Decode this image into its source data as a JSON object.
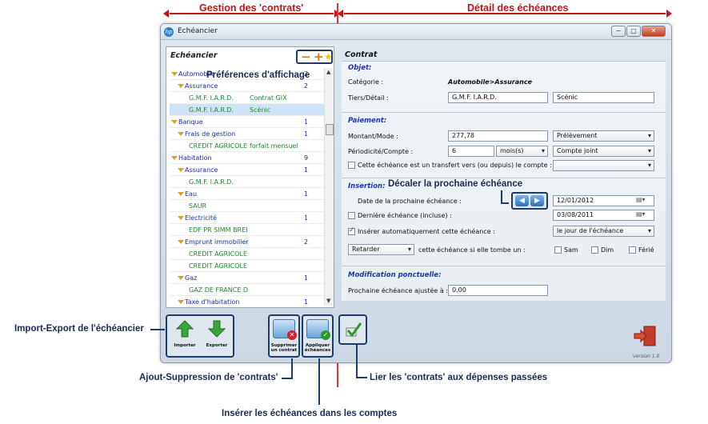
{
  "headers": {
    "left": "Gestion des 'contrats'",
    "right": "Détail des échéances"
  },
  "window": {
    "title": "Echéancier",
    "app_icon": "hp",
    "buttons": [
      "−",
      "▢",
      "✕"
    ]
  },
  "left": {
    "title": "Echéancier",
    "rows": [
      {
        "label": "Automobile",
        "count": "2",
        "level": 0
      },
      {
        "label": "Assurance",
        "count": "2",
        "level": 1
      },
      {
        "label": "G.M.F. I.A.R.D.",
        "detail": "Contrat GIX",
        "level": 2
      },
      {
        "label": "G.M.F. I.A.R.D.",
        "detail": "Scénic",
        "level": 2,
        "selected": true
      },
      {
        "label": "Banque",
        "count": "1",
        "level": 0
      },
      {
        "label": "Frais de gestion",
        "count": "1",
        "level": 1
      },
      {
        "label": "CREDIT AGRICOLE",
        "detail": "forfait mensuel",
        "level": 2
      },
      {
        "label": "Habitation",
        "count": "9",
        "level": 0
      },
      {
        "label": "Assurance",
        "count": "1",
        "level": 1
      },
      {
        "label": "G.M.F. I.A.R.D.",
        "level": 2
      },
      {
        "label": "Eau",
        "count": "1",
        "level": 1
      },
      {
        "label": "SAUR",
        "level": 2
      },
      {
        "label": "Electricité",
        "count": "1",
        "level": 1
      },
      {
        "label": "EDF PR SIMM BREI",
        "level": 2
      },
      {
        "label": "Emprunt immobilier",
        "count": "2",
        "level": 1
      },
      {
        "label": "CREDIT AGRICOLE",
        "level": 2
      },
      {
        "label": "CREDIT AGRICOLE",
        "level": 2
      },
      {
        "label": "Gaz",
        "count": "1",
        "level": 1
      },
      {
        "label": "GAZ DE FRANCE D",
        "level": 2
      },
      {
        "label": "Taxe d'habitation",
        "count": "1",
        "level": 1
      }
    ]
  },
  "contrat": {
    "title": "Contrat",
    "objet": {
      "title": "Objet:",
      "categorie_label": "Catégorie :",
      "categorie_value": "Automobile>Assurance",
      "tiers_label": "Tiers/Détail :",
      "tiers_value": "G.M.F. I.A.R.D.",
      "detail_value": "Scénic"
    },
    "paiement": {
      "title": "Paiement:",
      "montant_label": "Montant/Mode :",
      "montant_value": "277,78",
      "mode_value": "Prélèvement",
      "periodicite_label": "Périodicité/Compte :",
      "periodicite_value": "6",
      "unite_value": "mois(s)",
      "compte_value": "Compte joint",
      "transfert_label": "Cette échéance est un transfert vers (ou depuis) le compte :"
    },
    "insertion": {
      "title": "Insertion:",
      "date_label": "Date de la prochaine échéance :",
      "date_value": "12/01/2012",
      "derniere_label": "Dernière échéance (incluse) :",
      "derniere_value": "03/08/2011",
      "auto_label": "Insérer automatiquement cette échéance :",
      "auto_value": "le jour de l'échéance",
      "retarder_value": "Retarder",
      "tombe_label": "cette échéance si elle tombe un :",
      "sam": "Sam",
      "dim": "Dim",
      "ferie": "Férié"
    },
    "modif": {
      "title": "Modification ponctuelle:",
      "label": "Prochaine échéance ajustée à :",
      "value": "0,00"
    }
  },
  "toolbar": {
    "importer": "Importer",
    "exporter": "Exporter",
    "supprimer": "Supprimer un contrat",
    "appliquer": "Appliquer échéances"
  },
  "version": "version 1.0",
  "annotations": {
    "pref": "Préférences d'affichage",
    "decaler": "Décaler la prochaine échéance",
    "import": "Import-Export de l'échéancier",
    "ajout": "Ajout-Suppression de 'contrats'",
    "lier": "Lier les 'contrats' aux dépenses passées",
    "inserer": "Insérer les échéances dans les comptes"
  }
}
